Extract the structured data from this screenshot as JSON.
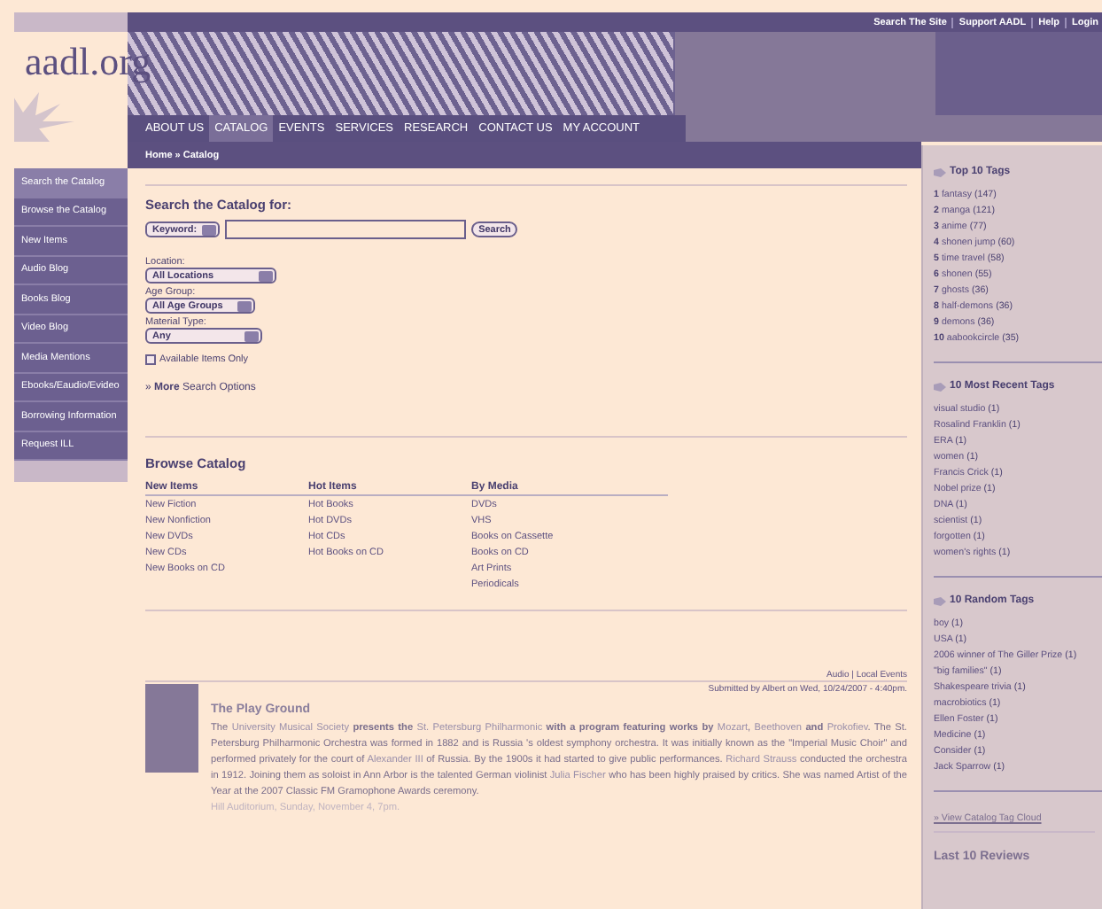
{
  "top_links": [
    "Search The Site",
    "Support AADL",
    "Help",
    "Login"
  ],
  "logo": "aadl.org",
  "nav": [
    {
      "label": "ABOUT US",
      "selected": false
    },
    {
      "label": "CATALOG",
      "selected": true
    },
    {
      "label": "EVENTS",
      "selected": false
    },
    {
      "label": "SERVICES",
      "selected": false
    },
    {
      "label": "RESEARCH",
      "selected": false
    },
    {
      "label": "CONTACT US",
      "selected": false
    },
    {
      "label": "MY ACCOUNT",
      "selected": false
    }
  ],
  "breadcrumb": "Home » Catalog",
  "sidebar": {
    "items": [
      {
        "label": "Search the Catalog",
        "selected": true
      },
      {
        "label": "Browse the Catalog",
        "selected": false
      },
      {
        "label": "New Items",
        "selected": false
      },
      {
        "label": "Audio Blog",
        "selected": false
      },
      {
        "label": "Books Blog",
        "selected": false
      },
      {
        "label": "Video Blog",
        "selected": false
      },
      {
        "label": "Media Mentions",
        "selected": false
      },
      {
        "label": "Ebooks/Eaudio/Evideo",
        "selected": false
      },
      {
        "label": "Borrowing Information",
        "selected": false
      },
      {
        "label": "Request ILL",
        "selected": false
      }
    ]
  },
  "search": {
    "title": "Search the Catalog for:",
    "type_select": "Keyword:",
    "button": "Search",
    "filters": [
      {
        "label": "Location:",
        "value": "All Locations"
      },
      {
        "label": "Age Group:",
        "value": "All Age Groups"
      },
      {
        "label": "Material Type:",
        "value": "Any"
      }
    ],
    "checkbox": {
      "label": "Available Items Only",
      "checked": false
    },
    "more_link": "» **More** Search Options"
  },
  "browse": {
    "title": "Browse Catalog",
    "columns": [
      {
        "heading": "New Items",
        "items": [
          "New Fiction",
          "New Nonfiction",
          "New DVDs",
          "New CDs",
          "New Books on CD"
        ]
      },
      {
        "heading": "Hot Items",
        "items": [
          "Hot Books",
          "Hot DVDs",
          "Hot CDs",
          "Hot Books on CD"
        ]
      },
      {
        "heading": "By Media",
        "items": [
          "DVDs",
          "VHS",
          "Books on Cassette",
          "Books on CD",
          "Art Prints",
          "Periodicals"
        ]
      }
    ]
  },
  "event": {
    "section_links": "Audio | Local Events",
    "submitted": "Submitted by Albert on Wed, 10/24/2007 - 4:40pm.",
    "title": "The Play Ground",
    "paragraph": [
      {
        "text": "The ",
        "link": false
      },
      {
        "text": "University Musical Society",
        "link": true
      },
      {
        "text": " **presents the** ",
        "link": false
      },
      {
        "text": "St. Petersburg Philharmonic",
        "link": true
      },
      {
        "text": " **with a program featuring works by** ",
        "link": false
      },
      {
        "text": "Mozart",
        "link": true
      },
      {
        "text": ", ",
        "link": false
      },
      {
        "text": "Beethoven",
        "link": true
      },
      {
        "text": " **and** ",
        "link": false
      },
      {
        "text": "Prokofiev",
        "link": true
      },
      {
        "text": ". The St. Petersburg Philharmonic Orchestra was formed in 1882 and is Russia 's oldest symphony orchestra. It was initially known as the \"Imperial Music Choir\" and performed privately for the court of ",
        "link": false
      },
      {
        "text": "Alexander III",
        "link": true
      },
      {
        "text": " of Russia. By the 1900s it had started to give public performances. ",
        "link": false
      },
      {
        "text": "Richard Strauss",
        "link": true
      },
      {
        "text": " conducted the orchestra in 1912. Joining them as soloist in Ann Arbor is the talented German violinist ",
        "link": false
      },
      {
        "text": "Julia Fischer",
        "link": true
      },
      {
        "text": " who has been highly praised by critics. She was named Artist of the Year at the 2007 Classic FM Gramophone Awards ceremony.",
        "link": false
      }
    ],
    "venue": "Hill Auditorium, Sunday, November 4, 7pm."
  },
  "tags": {
    "sections": [
      {
        "title": "Top 10 Tags",
        "items": [
          {
            "rank": "1",
            "tag": "fantasy",
            "count": "(147)"
          },
          {
            "rank": "2",
            "tag": "manga",
            "count": "(121)"
          },
          {
            "rank": "3",
            "tag": "anime",
            "count": "(77)"
          },
          {
            "rank": "4",
            "tag": "shonen jump",
            "count": "(60)"
          },
          {
            "rank": "5",
            "tag": "time travel",
            "count": "(58)"
          },
          {
            "rank": "6",
            "tag": "shonen",
            "count": "(55)"
          },
          {
            "rank": "7",
            "tag": "ghosts",
            "count": "(36)"
          },
          {
            "rank": "8",
            "tag": "half-demons",
            "count": "(36)"
          },
          {
            "rank": "9",
            "tag": "demons",
            "count": "(36)"
          },
          {
            "rank": "10",
            "tag": "aabookcircle",
            "count": "(35)"
          }
        ]
      },
      {
        "title": "10 Most Recent Tags",
        "items": [
          {
            "tag": "visual studio",
            "count": "(1)"
          },
          {
            "tag": "Rosalind Franklin",
            "count": "(1)"
          },
          {
            "tag": "ERA",
            "count": "(1)"
          },
          {
            "tag": "women",
            "count": "(1)"
          },
          {
            "tag": "Francis Crick",
            "count": "(1)"
          },
          {
            "tag": "Nobel prize",
            "count": "(1)"
          },
          {
            "tag": "DNA",
            "count": "(1)"
          },
          {
            "tag": "scientist",
            "count": "(1)"
          },
          {
            "tag": "forgotten",
            "count": "(1)"
          },
          {
            "tag": "women's rights",
            "count": "(1)"
          }
        ]
      },
      {
        "title": "10 Random Tags",
        "items": [
          {
            "tag": "boy",
            "count": "(1)"
          },
          {
            "tag": "USA",
            "count": "(1)"
          },
          {
            "tag": "2006 winner of The Giller Prize",
            "count": "(1)"
          },
          {
            "tag": "\"big families\"",
            "count": "(1)"
          },
          {
            "tag": "Shakespeare trivia",
            "count": "(1)"
          },
          {
            "tag": "macrobiotics",
            "count": "(1)"
          },
          {
            "tag": "Ellen Foster",
            "count": "(1)"
          },
          {
            "tag": "Medicine",
            "count": "(1)"
          },
          {
            "tag": "Consider",
            "count": "(1)"
          },
          {
            "tag": "Jack Sparrow",
            "count": "(1)"
          }
        ]
      }
    ],
    "cloud_link": "» View Catalog Tag Cloud",
    "reviews_title": "Last 10 Reviews"
  }
}
